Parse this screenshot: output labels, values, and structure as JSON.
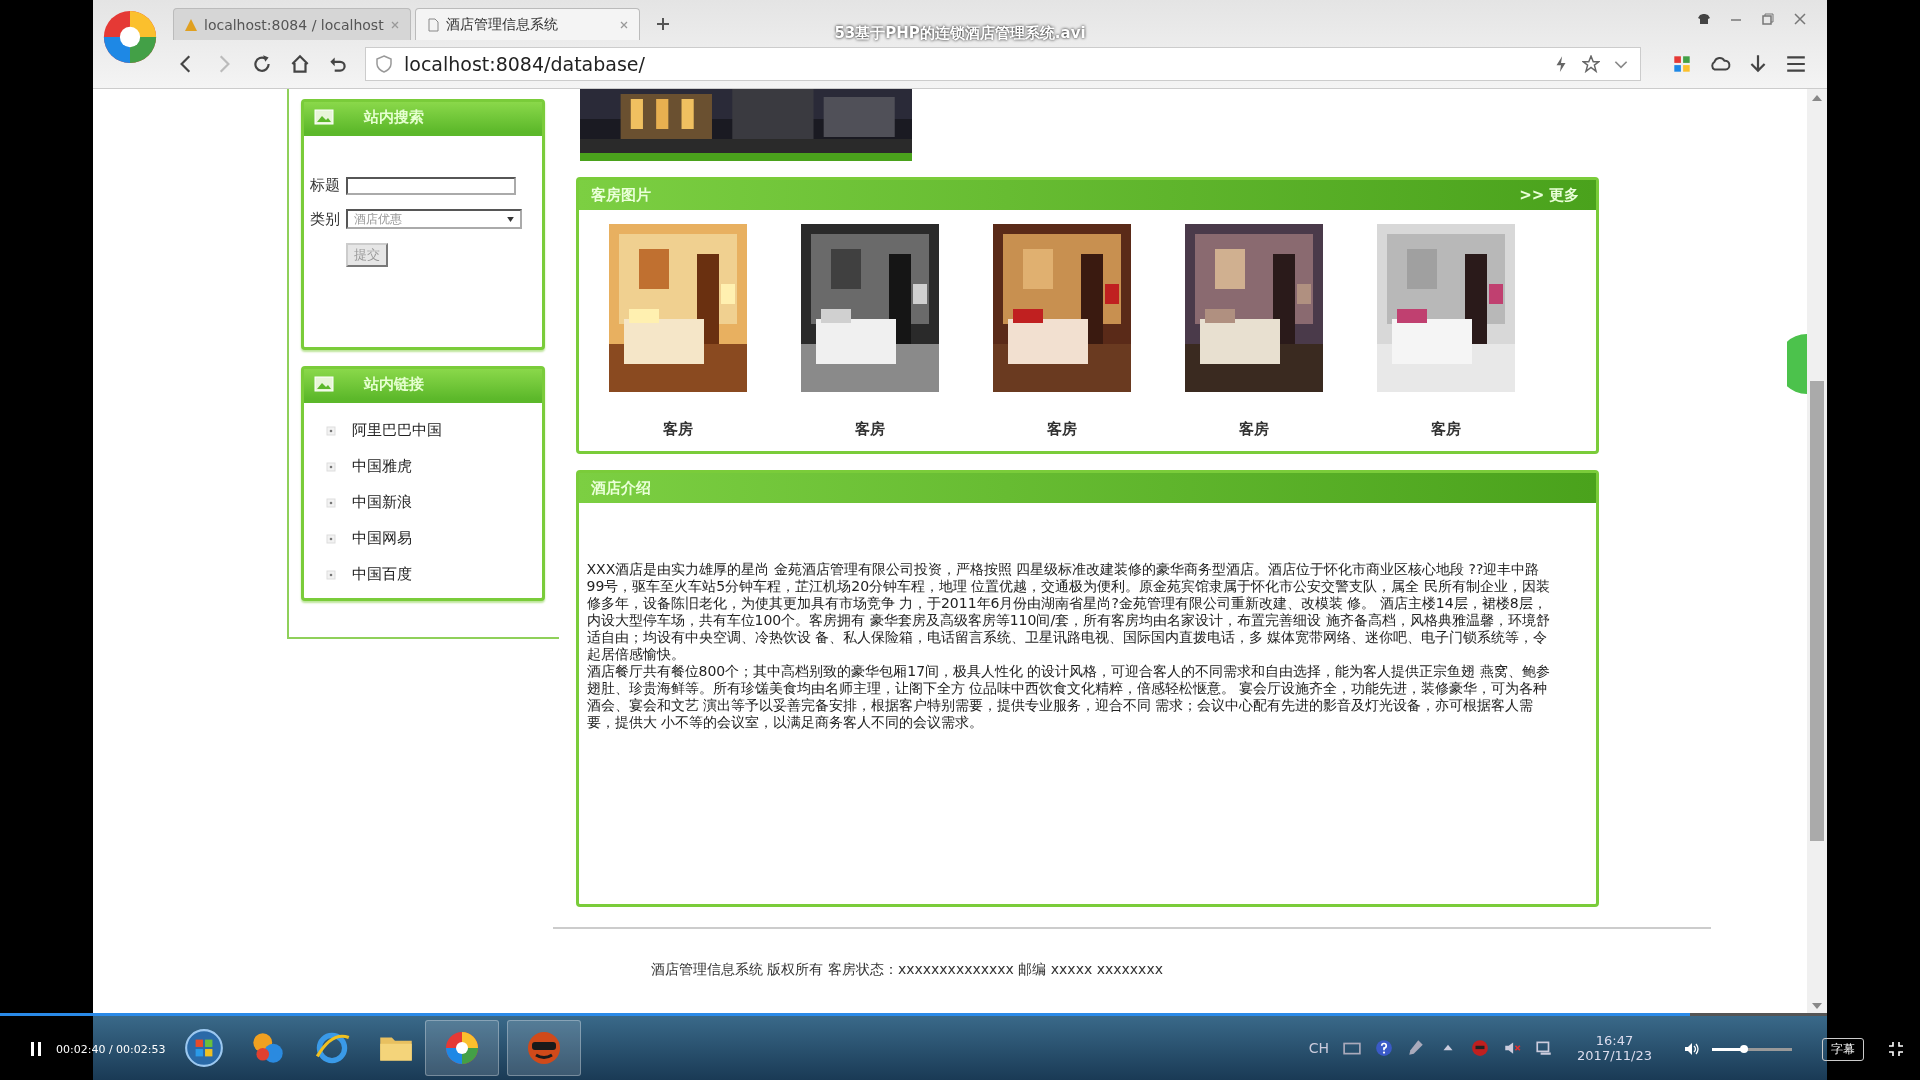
{
  "video_title": "53基于PHP的连锁酒店管理系统.avi",
  "browser": {
    "tabs": [
      {
        "label": "localhost:8084 / localhost",
        "selected": false
      },
      {
        "label": "酒店管理信息系统",
        "selected": true
      }
    ],
    "address": "localhost:8084/database/"
  },
  "sidebar": {
    "search_panel": {
      "title": "站内搜索",
      "fields": [
        {
          "label": "标题",
          "kind": "text"
        },
        {
          "label": "类别",
          "kind": "select",
          "value": "酒店优惠"
        }
      ],
      "submit": "提交"
    },
    "links_panel": {
      "title": "站内链接",
      "items": [
        "阿里巴巴中国",
        "中国雅虎",
        "中国新浪",
        "中国网易",
        "中国百度"
      ]
    }
  },
  "rooms": {
    "title": "客房图片",
    "more": ">> 更多",
    "items": [
      {
        "kind": "picture",
        "caption": "客房"
      },
      {
        "kind": "picture",
        "caption": "客房"
      },
      {
        "kind": "picture",
        "caption": "客房"
      },
      {
        "kind": "picture",
        "caption": "客房"
      },
      {
        "kind": "picture",
        "caption": "客房"
      }
    ]
  },
  "intro": {
    "title": "酒店介绍",
    "paragraphs": [
      "XXX酒店是由实力雄厚的星尚 金苑酒店管理有限公司投资，严格按照 四星级标准改建装修的豪华商务型酒店。酒店位于怀化市商业区核心地段 ??迎丰中路99号，驱车至火车站5分钟车程，芷江机场20分钟车程，地理 位置优越，交通极为便利。原金苑宾馆隶属于怀化市公安交警支队，属全 民所有制企业，因装修多年，设备陈旧老化，为使其更加具有市场竞争 力，于2011年6月份由湖南省星尚?金苑管理有限公司重新改建、改模装 修。 酒店主楼14层，裙楼8层，内设大型停车场，共有车位100个。客房拥有 豪华套房及高级客房等110间/套，所有客房均由名家设计，布置完善细设 施齐备高档，风格典雅温馨，环境舒适自由；均设有中央空调、冷热饮设 备、私人保险箱，电话留言系统、卫星讯路电视、国际国内直拨电话，多 媒体宽带网络、迷你吧、电子门锁系统等，令起居倍感愉快。",
      "酒店餐厅共有餐位800个；其中高档别致的豪华包厢17间，极具人性化 的设计风格，可迎合客人的不同需求和自由选择，能为客人提供正宗鱼翅 燕窝、鲍参翅肚、珍贵海鲜等。所有珍馐美食均由名师主理，让阁下全方 位品味中西饮食文化精粹，倍感轻松惬意。 宴会厅设施齐全，功能先进，装修豪华，可为各种酒会、宴会和文艺 演出等予以妥善完备安排，根据客户特别需要，提供专业服务，迎合不同 需求；会议中心配有先进的影音及灯光设备，亦可根据客人需要，提供大 小不等的会议室，以满足商务客人不同的会议需求。"
    ]
  },
  "footer": "酒店管理信息系统 版权所有 客房状态：xxxxxxxxxxxxxx 邮编 xxxxx xxxxxxxx",
  "taskbar": {
    "language": "CH",
    "time": "16:47",
    "date": "2017/11/23"
  },
  "player": {
    "playing": true,
    "time": "00:02:40 / 00:02:53",
    "progress": {
      "level": 0.925
    },
    "volume": {
      "level": 0.4
    },
    "subtitle_button": "字幕"
  }
}
